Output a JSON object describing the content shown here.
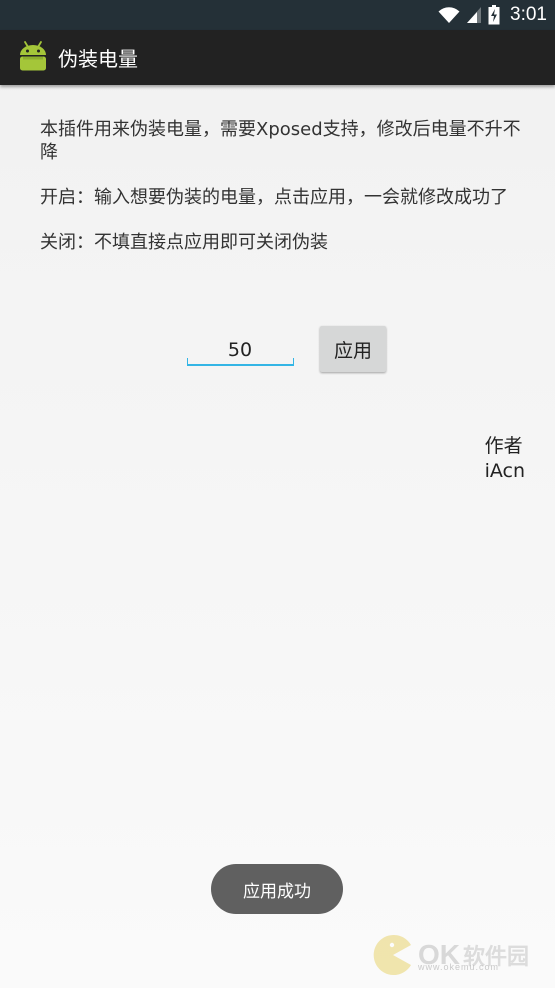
{
  "status_bar": {
    "time": "3:01",
    "icons": [
      "wifi-icon",
      "signal-icon",
      "battery-charging-icon"
    ]
  },
  "action_bar": {
    "app_icon": "android-icon",
    "title": "伪装电量"
  },
  "content": {
    "paragraphs": [
      "本插件用来伪装电量，需要Xposed支持，修改后电量不升不降",
      "开启：输入想要伪装的电量，点击应用，一会就修改成功了",
      "关闭：不填直接点应用即可关闭伪装"
    ]
  },
  "form": {
    "input_value": "50",
    "apply_label": "应用"
  },
  "author": {
    "label": "作者",
    "name": "iAcn"
  },
  "toast": {
    "text": "应用成功"
  },
  "watermark": {
    "brand": "OK",
    "brand_cn": "软件园",
    "url": "www.okemu.com"
  },
  "colors": {
    "status_bar": "#243037",
    "action_bar": "#222222",
    "accent": "#33b5e5",
    "android_green": "#a4c639",
    "button": "#d6d7d7",
    "toast": "#606060"
  }
}
